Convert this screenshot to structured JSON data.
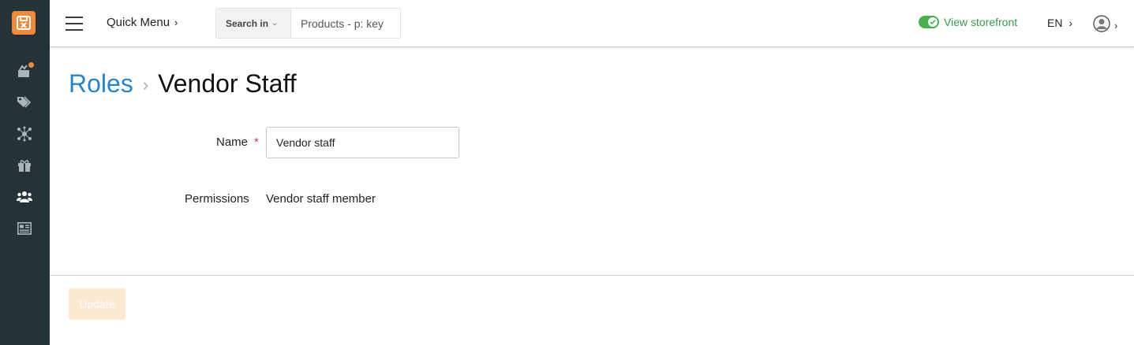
{
  "sidebar": {
    "logo": "xcart-logo-icon",
    "items": [
      {
        "icon": "store-dashboard-icon",
        "has_badge": true
      },
      {
        "icon": "tags-icon",
        "has_badge": false
      },
      {
        "icon": "network-icon",
        "has_badge": false
      },
      {
        "icon": "gift-icon",
        "has_badge": false
      },
      {
        "icon": "users-icon",
        "has_badge": false
      },
      {
        "icon": "content-icon",
        "has_badge": false
      }
    ]
  },
  "topbar": {
    "quick_menu_label": "Quick Menu",
    "search": {
      "scope_label": "Search in",
      "placeholder": "Products - p: key"
    },
    "storefront_label": "View storefront",
    "storefront_enabled": true,
    "language": "EN"
  },
  "breadcrumb": {
    "parent": "Roles",
    "current": "Vendor Staff"
  },
  "form": {
    "name_label": "Name",
    "required_mark": "*",
    "name_value": "Vendor staff",
    "permissions_label": "Permissions",
    "permissions_value": "Vendor staff member"
  },
  "footer": {
    "update_label": "Update"
  },
  "colors": {
    "sidebar_bg": "#253238",
    "accent": "#f08a3c",
    "link": "#2a84c8",
    "storefront_green": "#3a9a4a",
    "required": "#b8454a",
    "update_disabled_bg": "#fde9d2"
  }
}
